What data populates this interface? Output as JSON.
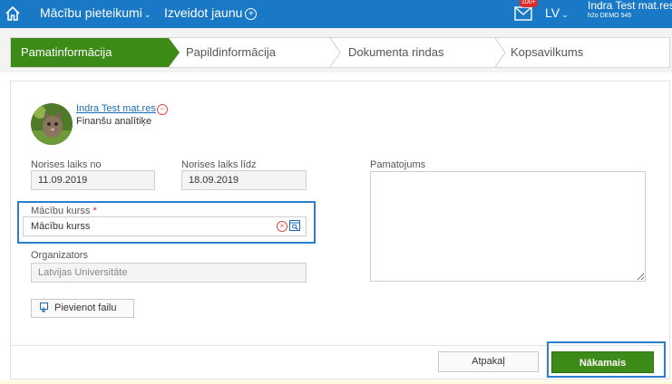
{
  "topbar": {
    "nav_requests": "Mācību pieteikumi",
    "nav_create": "Izveidot jaunu",
    "mail_badge": "100+",
    "language": "LV",
    "user_name": "Indra Test mat.res",
    "tenant": "h2o DEMO 545"
  },
  "steps": [
    "Pamatinformācija",
    "Papildinformācija",
    "Dokumenta rindas",
    "Kopsavilkums"
  ],
  "employee": {
    "name": "Indra Test mat.res",
    "role": "Finanšu analītiķe"
  },
  "form": {
    "date_from_label": "Norises laiks no",
    "date_from_value": "11.09.2019",
    "date_to_label": "Norises laiks līdz",
    "date_to_value": "18.09.2019",
    "justification_label": "Pamatojums",
    "course_label": "Mācību kurss",
    "course_required": "*",
    "course_value": "Mācību kurss",
    "organizer_label": "Organizators",
    "organizer_value": "Latvijas Universitāte",
    "attach_label": "Pievienot failu"
  },
  "footer": {
    "back_label": "Atpakaļ",
    "next_label": "Nākamais"
  },
  "colors": {
    "topbar": "#1a79c7",
    "accent_green": "#3c8a17",
    "highlight": "#2c7ed0",
    "required": "#d9232d"
  }
}
